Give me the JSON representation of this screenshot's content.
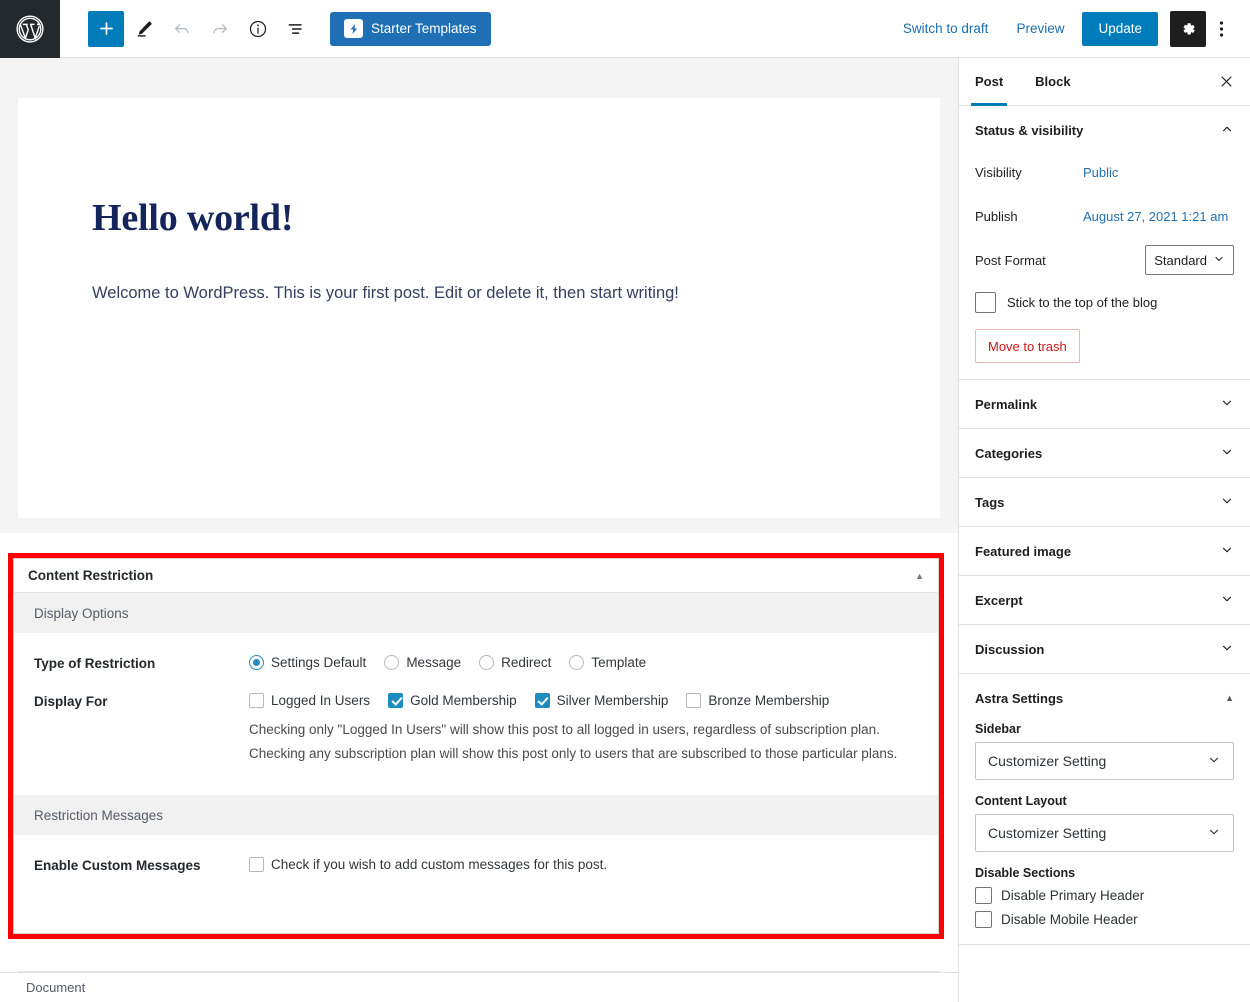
{
  "toolbar": {
    "logo_icon": "wordpress-logo-icon",
    "add_block_label": "+",
    "add_block_icon": "plus-icon",
    "edit_icon": "pencil-icon",
    "undo_icon": "undo-arrow-icon",
    "redo_icon": "redo-arrow-icon",
    "info_icon": "info-circle-icon",
    "list_view_icon": "list-view-icon",
    "starter_templates_label": "Starter Templates",
    "starter_templates_icon": "starter-templates-badge-icon",
    "switch_to_draft_label": "Switch to draft",
    "preview_label": "Preview",
    "update_label": "Update",
    "settings_icon": "gear-icon",
    "more_options_icon": "kebab-menu-icon",
    "accent_color": "#007cba",
    "starter_templates_color": "#1f6fb5"
  },
  "editor": {
    "post_title": "Hello world!",
    "post_paragraph": "Welcome to WordPress. This is your first post. Edit or delete it, then start writing!",
    "title_color": "#15255b",
    "canvas_background": "#f4f4f4"
  },
  "highlight": {
    "color": "#ff0000",
    "target": "content-restriction-metabox"
  },
  "metabox": {
    "title": "Content Restriction",
    "collapse_icon": "triangle-up-icon",
    "sections": [
      {
        "heading": "Display Options"
      },
      {
        "heading": "Restriction Messages"
      }
    ],
    "type_of_restriction": {
      "label": "Type of Restriction",
      "options": [
        {
          "label": "Settings Default",
          "checked": true
        },
        {
          "label": "Message",
          "checked": false
        },
        {
          "label": "Redirect",
          "checked": false
        },
        {
          "label": "Template",
          "checked": false
        }
      ]
    },
    "display_for": {
      "label": "Display For",
      "options": [
        {
          "label": "Logged In Users",
          "checked": false
        },
        {
          "label": "Gold Membership",
          "checked": true
        },
        {
          "label": "Silver Membership",
          "checked": true
        },
        {
          "label": "Bronze Membership",
          "checked": false
        }
      ],
      "helper_text": "Checking only \"Logged In Users\" will show this post to all logged in users, regardless of subscription plan. Checking any subscription plan will show this post only to users that are subscribed to those particular plans."
    },
    "enable_custom_messages": {
      "label": "Enable Custom Messages",
      "checkbox_label": "Check if you wish to add custom messages for this post.",
      "checked": false
    }
  },
  "sidebar": {
    "tabs": [
      {
        "label": "Post",
        "active": true
      },
      {
        "label": "Block",
        "active": false
      }
    ],
    "close_icon": "close-x-icon",
    "status_visibility": {
      "title": "Status & visibility",
      "toggle_icon": "chevron-up-icon",
      "visibility_label": "Visibility",
      "visibility_value": "Public",
      "publish_label": "Publish",
      "publish_value": "August 27, 2021 1:21 am",
      "post_format_label": "Post Format",
      "post_format_value": "Standard",
      "post_format_icon": "chevron-down-icon",
      "sticky_label": "Stick to the top of the blog",
      "sticky_checked": false,
      "trash_label": "Move to trash",
      "trash_color": "#cc1818"
    },
    "panels": [
      {
        "label": "Permalink",
        "icon": "chevron-down-icon"
      },
      {
        "label": "Categories",
        "icon": "chevron-down-icon"
      },
      {
        "label": "Tags",
        "icon": "chevron-down-icon"
      },
      {
        "label": "Featured image",
        "icon": "chevron-down-icon"
      },
      {
        "label": "Excerpt",
        "icon": "chevron-down-icon"
      },
      {
        "label": "Discussion",
        "icon": "chevron-down-icon"
      }
    ],
    "astra": {
      "title": "Astra Settings",
      "toggle_icon": "triangle-up-icon",
      "sidebar_label": "Sidebar",
      "sidebar_value": "Customizer Setting",
      "content_layout_label": "Content Layout",
      "content_layout_value": "Customizer Setting",
      "disable_sections_label": "Disable Sections",
      "disable_options": [
        {
          "label": "Disable Primary Header",
          "checked": false
        },
        {
          "label": "Disable Mobile Header",
          "checked": false
        }
      ]
    }
  },
  "statusbar": {
    "label": "Document"
  }
}
